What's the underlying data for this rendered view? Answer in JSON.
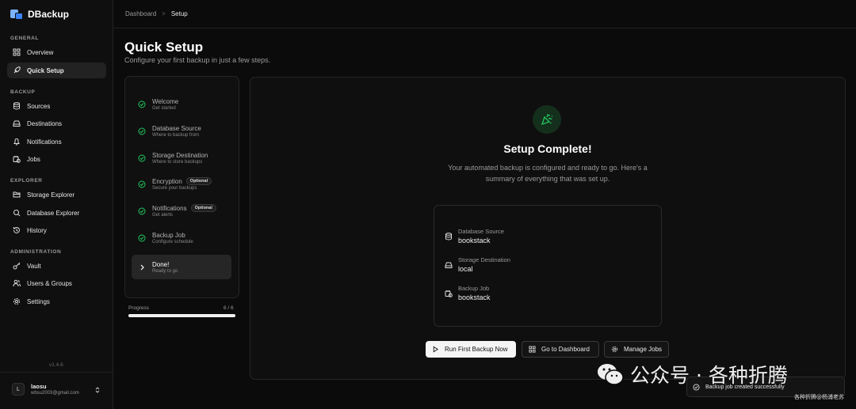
{
  "app": {
    "name": "DBackup"
  },
  "sidebar": {
    "sections": [
      "GENERAL",
      "BACKUP",
      "EXPLORER",
      "ADMINISTRATION"
    ],
    "items": [
      {
        "label": "Overview",
        "icon": "grid-icon"
      },
      {
        "label": "Quick Setup",
        "icon": "rocket-icon",
        "active": true
      },
      {
        "label": "Sources",
        "icon": "database-icon"
      },
      {
        "label": "Destinations",
        "icon": "hard-drive-icon"
      },
      {
        "label": "Notifications",
        "icon": "bell-icon"
      },
      {
        "label": "Jobs",
        "icon": "calendar-clock-icon"
      },
      {
        "label": "Storage Explorer",
        "icon": "folder-search-icon"
      },
      {
        "label": "Database Explorer",
        "icon": "database-search-icon"
      },
      {
        "label": "History",
        "icon": "history-icon"
      },
      {
        "label": "Vault",
        "icon": "key-icon"
      },
      {
        "label": "Users & Groups",
        "icon": "users-icon"
      },
      {
        "label": "Settings",
        "icon": "gear-icon"
      }
    ],
    "version": "v1.4.6",
    "user": {
      "initial": "L",
      "name": "laosu",
      "email": "wbsu2003@gmail.com"
    }
  },
  "breadcrumb": {
    "parent": "Dashboard",
    "separator": ">",
    "current": "Setup"
  },
  "page": {
    "title": "Quick Setup",
    "subtitle": "Configure your first backup in just a few steps."
  },
  "steps": [
    {
      "title": "Welcome",
      "desc": "Get started",
      "done": true
    },
    {
      "title": "Database Source",
      "desc": "Where to backup from",
      "done": true
    },
    {
      "title": "Storage Destination",
      "desc": "Where to store backups",
      "done": true
    },
    {
      "title": "Encryption",
      "desc": "Secure your backups",
      "badge": "Optional",
      "done": true
    },
    {
      "title": "Notifications",
      "desc": "Get alerts",
      "badge": "Optional",
      "done": true
    },
    {
      "title": "Backup Job",
      "desc": "Configure schedule",
      "done": true
    },
    {
      "title": "Done!",
      "desc": "Ready to go",
      "active": true
    }
  ],
  "progress": {
    "label": "Progress",
    "count": "6 / 6",
    "fraction": 1.0
  },
  "complete": {
    "title": "Setup Complete!",
    "description": "Your automated backup is configured and ready to go. Here's a summary of everything that was set up."
  },
  "summary": [
    {
      "label": "Database Source",
      "value": "bookstack",
      "icon": "database-icon"
    },
    {
      "label": "Storage Destination",
      "value": "local",
      "icon": "hard-drive-icon"
    },
    {
      "label": "Backup Job",
      "value": "bookstack",
      "icon": "calendar-clock-icon"
    }
  ],
  "actions": {
    "run": "Run First Backup Now",
    "dashboard": "Go to Dashboard",
    "manage": "Manage Jobs"
  },
  "toast": {
    "message": "Backup job created successfully"
  },
  "watermark": {
    "text": "公众号 · 各种折腾",
    "small": "各种折腾@杨浦老苏"
  },
  "colors": {
    "accent_green": "#22c55e",
    "brand_blue": "#3b82f6"
  }
}
